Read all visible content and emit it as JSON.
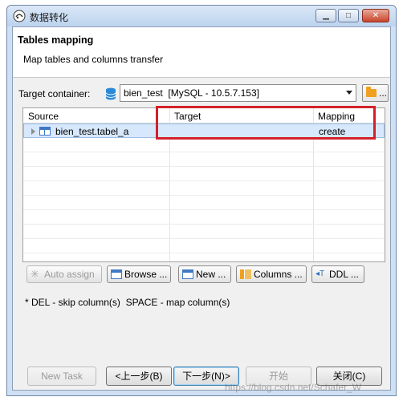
{
  "window": {
    "title": "数据转化"
  },
  "header": {
    "title": "Tables mapping",
    "description": "Map tables and columns transfer"
  },
  "target_container": {
    "label": "Target container:",
    "value": "bien_test  [MySQL - 10.5.7.153]",
    "browse_label": "..."
  },
  "table": {
    "columns": [
      "Source",
      "Target",
      "Mapping"
    ],
    "rows": [
      {
        "source": "bien_test.tabel_a",
        "target": "",
        "mapping": "create"
      }
    ]
  },
  "actions": {
    "auto_assign": "Auto assign",
    "browse": "Browse ...",
    "new": "New ...",
    "columns": "Columns ...",
    "ddl": "DDL ..."
  },
  "hint": "* DEL - skip column(s)  SPACE - map column(s)",
  "footer": {
    "new_task": "New Task",
    "prev": "<上一步(B)",
    "next": "下一步(N)>",
    "start": "开始",
    "close": "关闭(C)"
  },
  "watermark": "https://blog.csdn.net/Schafer_W",
  "colors": {
    "highlight_border": "#d4202a",
    "selection_bg": "#d7e8fc",
    "accent": "#3f79c5"
  }
}
